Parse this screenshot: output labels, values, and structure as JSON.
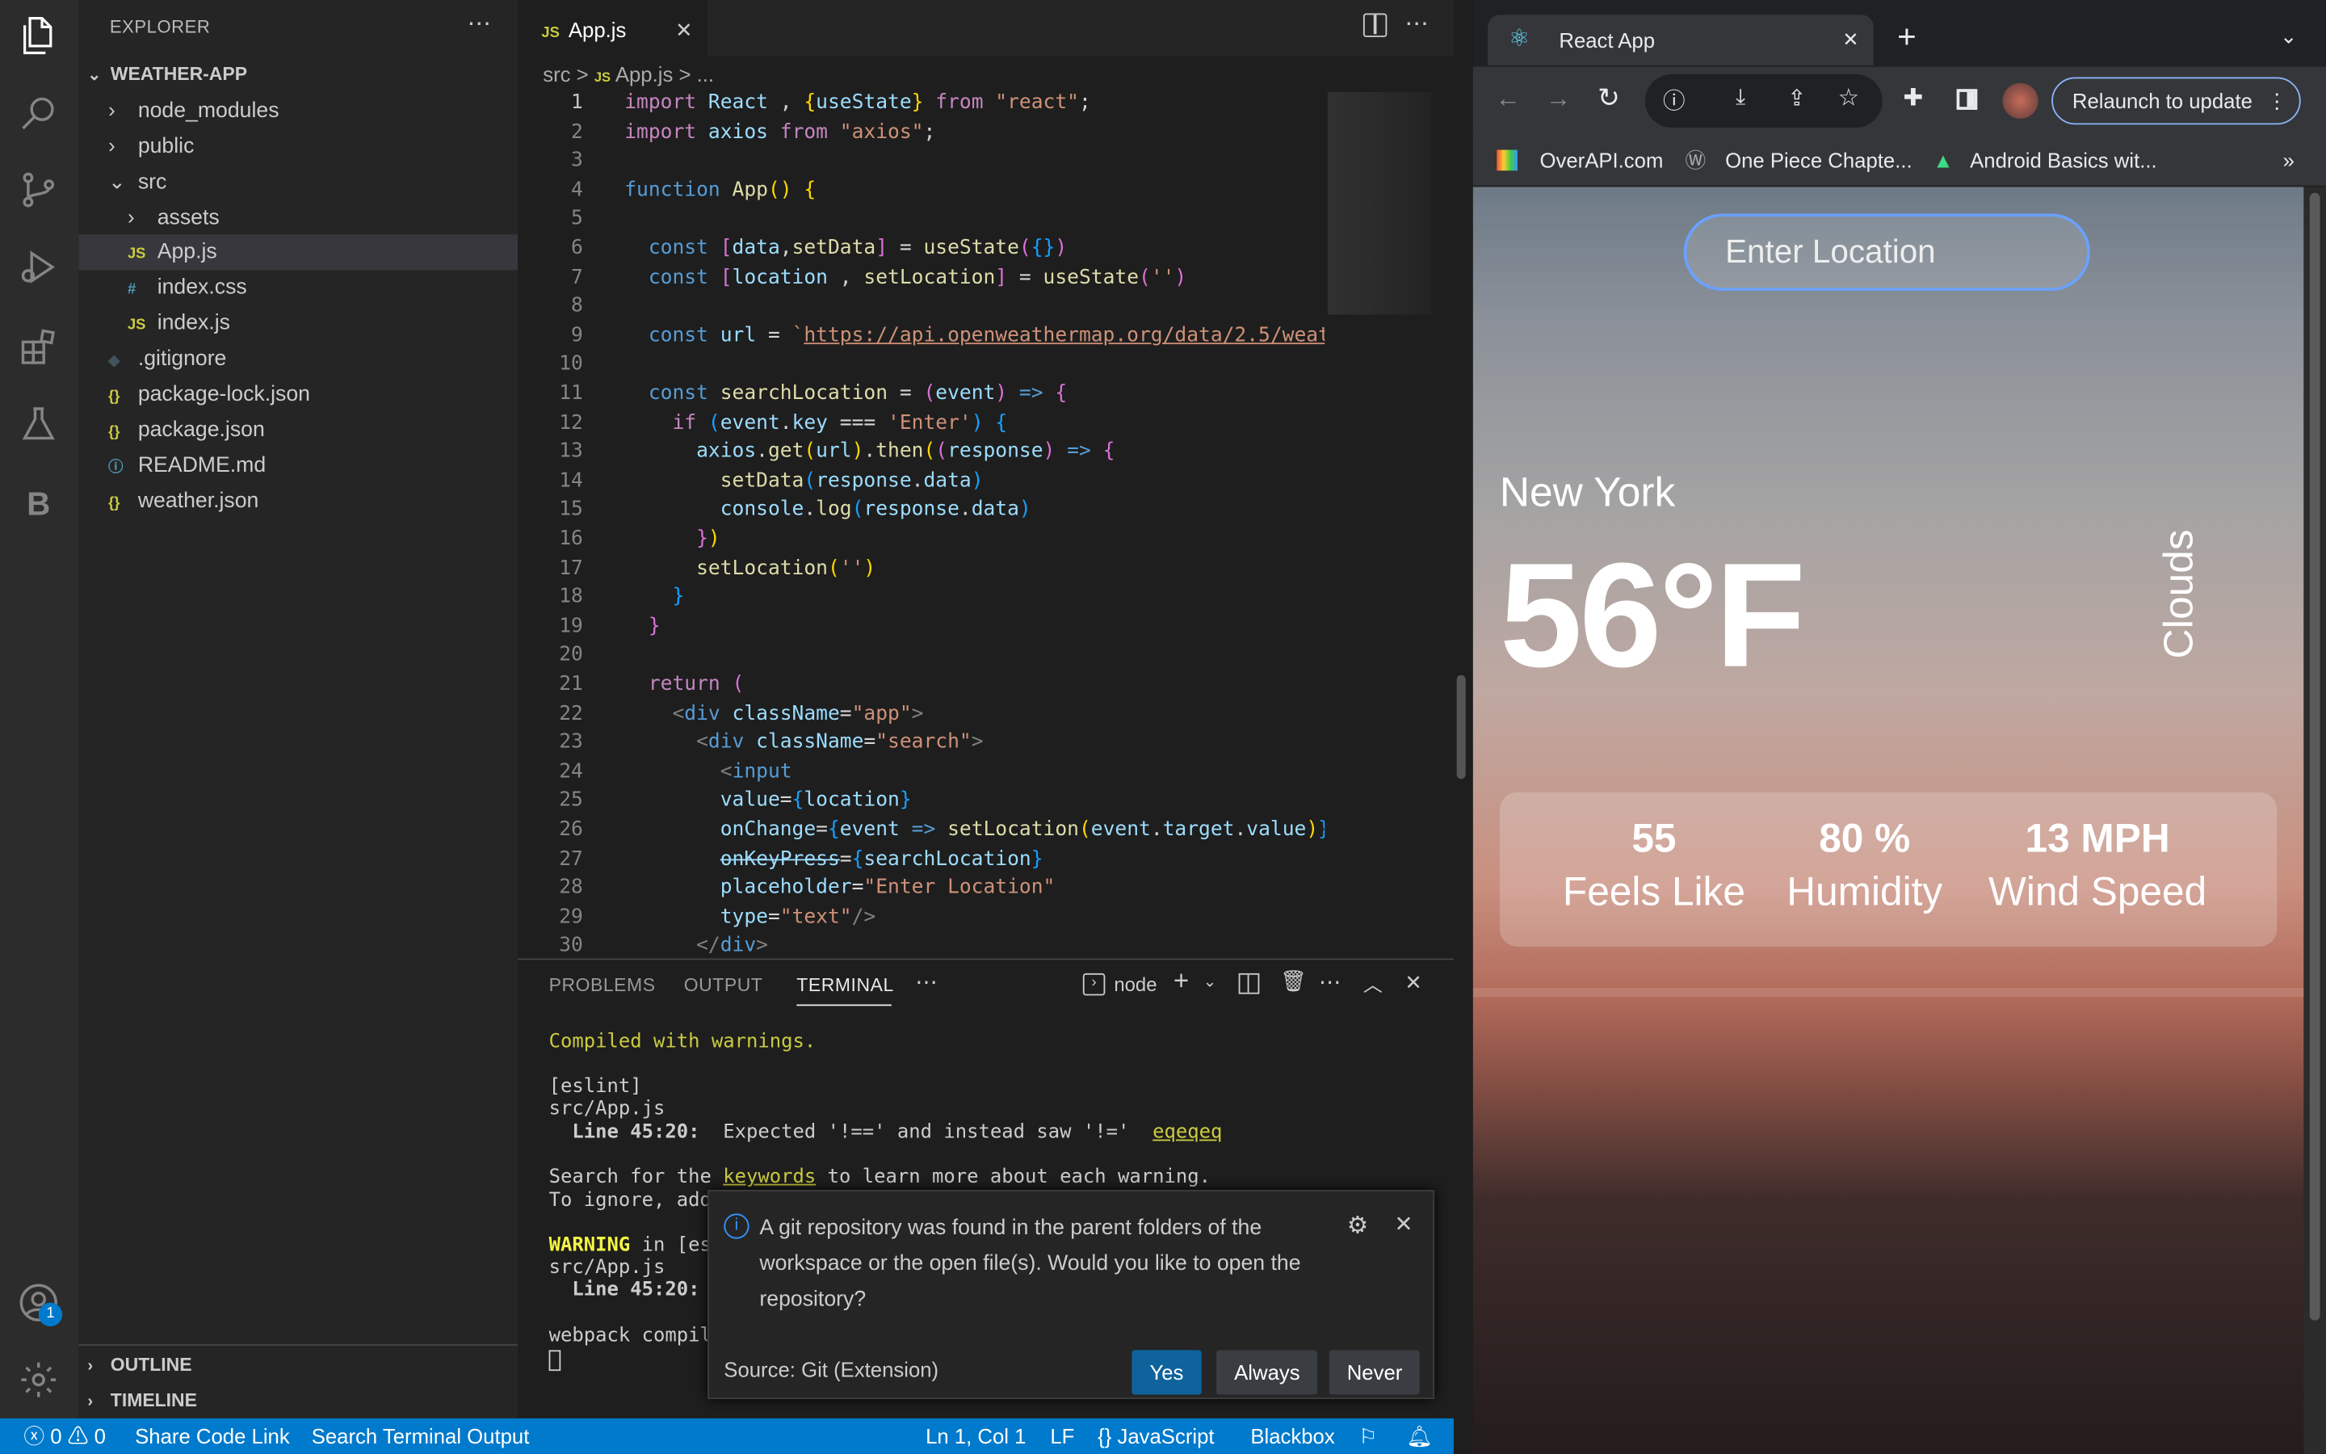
{
  "activity": {
    "badge": "1"
  },
  "explorer": {
    "title": "EXPLORER",
    "project": "WEATHER-APP",
    "items": [
      {
        "label": "node_modules",
        "icon": "›",
        "indent": 0
      },
      {
        "label": "public",
        "icon": "›",
        "indent": 0
      },
      {
        "label": "src",
        "icon": "⌄",
        "indent": 0
      },
      {
        "label": "assets",
        "icon": "›",
        "indent": 1
      },
      {
        "label": "App.js",
        "icon": "JS",
        "indent": 1
      },
      {
        "label": "index.css",
        "icon": "#",
        "indent": 1
      },
      {
        "label": "index.js",
        "icon": "JS",
        "indent": 1
      },
      {
        "label": ".gitignore",
        "icon": "◆",
        "indent": 0
      },
      {
        "label": "package-lock.json",
        "icon": "{}",
        "indent": 0
      },
      {
        "label": "package.json",
        "icon": "{}",
        "indent": 0
      },
      {
        "label": "README.md",
        "icon": "ⓘ",
        "indent": 0
      },
      {
        "label": "weather.json",
        "icon": "{}",
        "indent": 0
      }
    ],
    "outline": "OUTLINE",
    "timeline": "TIMELINE"
  },
  "editor": {
    "tab_icon": "JS",
    "tab_label": "App.js",
    "breadcrumb": {
      "p1": "src",
      "sep": ">",
      "p2": "App.js",
      "p3": "..."
    },
    "lines": [
      "1",
      "2",
      "3",
      "4",
      "5",
      "6",
      "7",
      "8",
      "9",
      "10",
      "11",
      "12",
      "13",
      "14",
      "15",
      "16",
      "17",
      "18",
      "19",
      "20",
      "21",
      "22",
      "23",
      "24",
      "25",
      "26",
      "27",
      "28",
      "29",
      "30"
    ]
  },
  "panel": {
    "tabs": [
      "PROBLEMS",
      "OUTPUT",
      "TERMINAL"
    ],
    "shell": "node",
    "terminal": {
      "l1": "Compiled with warnings.",
      "l2": "[eslint]",
      "l3": "src/App.js",
      "l4a": "  Line 45:20:",
      "l4b": "  Expected '!==' and instead saw '!='  ",
      "l4c": "eqeqeq",
      "l5a": "Search for the ",
      "l5b": "keywords",
      "l5c": " to learn more about each warning.",
      "l6": "To ignore, add",
      "l7a": "WARNING",
      "l7b": " in [es",
      "l8": "src/App.js",
      "l9": "  Line 45:20:",
      "l10": "webpack compil"
    }
  },
  "notification": {
    "message": "A git repository was found in the parent folders of the workspace or the open file(s). Would you like to open the repository?",
    "source": "Source: Git (Extension)",
    "yes": "Yes",
    "always": "Always",
    "never": "Never"
  },
  "status": {
    "errors": "0",
    "warnings": "0",
    "share": "Share Code Link",
    "search": "Search Terminal Output",
    "position": "Ln 1, Col 1",
    "eol": "LF",
    "language": "JavaScript",
    "ext": "Blackbox"
  },
  "browser": {
    "tab_title": "React App",
    "relaunch": "Relaunch to update",
    "bookmarks": [
      "OverAPI.com",
      "One Piece Chapte...",
      "Android Basics wit..."
    ],
    "more": "»"
  },
  "weather": {
    "placeholder": "Enter Location",
    "city": "New York",
    "temp": "56°F",
    "description": "Clouds",
    "feels_value": "55",
    "feels_label": "Feels Like",
    "humidity_value": "80 %",
    "humidity_label": "Humidity",
    "wind_value": "13 MPH",
    "wind_label": "Wind Speed"
  }
}
